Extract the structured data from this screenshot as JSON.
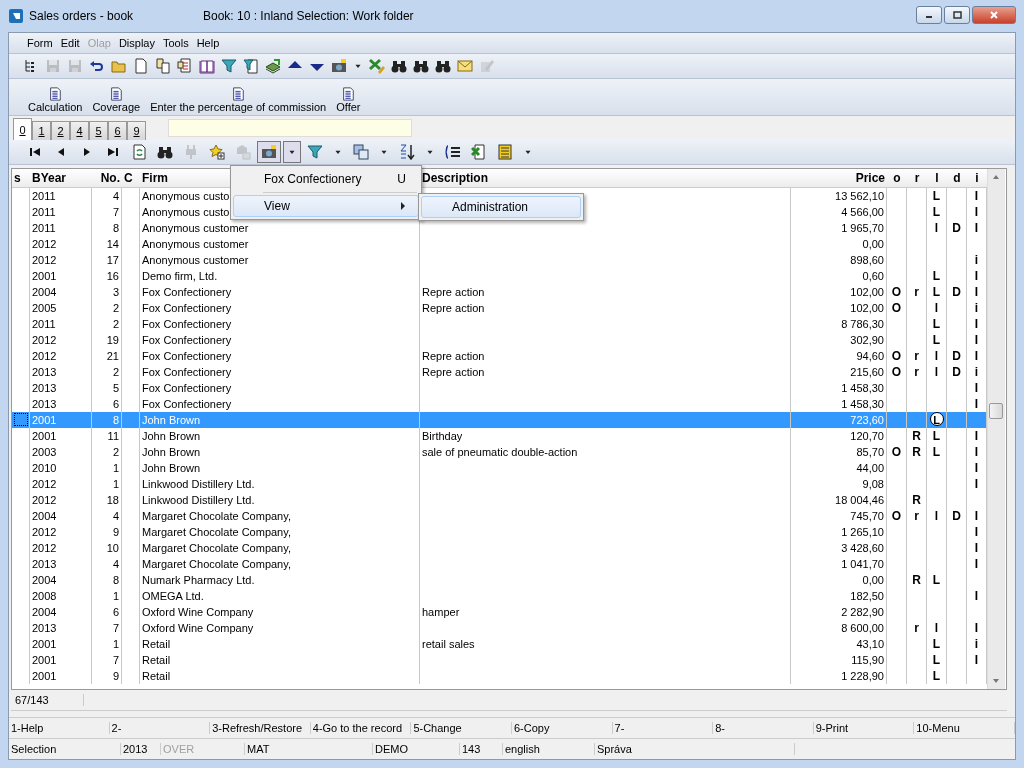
{
  "window": {
    "title": "Sales orders - book",
    "subtitle": "Book: 10 : Inland Selection: Work folder"
  },
  "menu": [
    {
      "label": "Form",
      "disabled": false
    },
    {
      "label": "Edit",
      "disabled": false
    },
    {
      "label": "Olap",
      "disabled": true
    },
    {
      "label": "Display",
      "disabled": false
    },
    {
      "label": "Tools",
      "disabled": false
    },
    {
      "label": "Help",
      "disabled": false
    }
  ],
  "toolbar": [
    {
      "disabled": false
    },
    {
      "disabled": true
    },
    {
      "disabled": true
    },
    {
      "disabled": false
    },
    {
      "disabled": false
    },
    {
      "disabled": false
    },
    {
      "disabled": false
    },
    {
      "disabled": false
    },
    {
      "disabled": false
    },
    {
      "disabled": false
    },
    {
      "disabled": false
    },
    {
      "disabled": false
    },
    {
      "disabled": false
    },
    {
      "disabled": false
    },
    {
      "disabled": false
    },
    {
      "disabled": false
    },
    {
      "disabled": false
    },
    {
      "disabled": false
    },
    {
      "disabled": false
    },
    {
      "disabled": false
    },
    {
      "disabled": false
    },
    {
      "disabled": true
    }
  ],
  "actions": [
    "Calculation",
    "Coverage",
    "Enter the percentage of commission",
    "Offer"
  ],
  "tabs": [
    {
      "label": "0",
      "selected": true
    },
    {
      "label": "1",
      "selected": false
    },
    {
      "label": "2",
      "selected": false
    },
    {
      "label": "4",
      "selected": false
    },
    {
      "label": "5",
      "selected": false
    },
    {
      "label": "6",
      "selected": false
    },
    {
      "label": "9",
      "selected": false
    }
  ],
  "nav_toolbar": [
    {
      "disabled": false,
      "pressed": false
    },
    {
      "disabled": false,
      "pressed": false
    },
    {
      "disabled": false,
      "pressed": false
    },
    {
      "disabled": false,
      "pressed": false
    },
    {
      "disabled": false,
      "pressed": false
    },
    {
      "disabled": false,
      "pressed": false
    },
    {
      "disabled": true,
      "pressed": false
    },
    {
      "disabled": false,
      "pressed": false
    },
    {
      "disabled": true,
      "pressed": false
    },
    {
      "disabled": false,
      "pressed": true
    },
    {
      "disabled": false,
      "pressed": true
    },
    {
      "disabled": false,
      "pressed": false
    },
    {
      "disabled": false,
      "pressed": false
    },
    {
      "disabled": false,
      "pressed": false
    },
    {
      "disabled": false,
      "pressed": false
    },
    {
      "disabled": false,
      "pressed": false
    },
    {
      "disabled": false,
      "pressed": false
    },
    {
      "disabled": false,
      "pressed": false
    },
    {
      "disabled": false,
      "pressed": false
    },
    {
      "disabled": false,
      "pressed": false
    },
    {
      "disabled": false,
      "pressed": false
    }
  ],
  "table": {
    "columns": [
      "s",
      "BYear",
      "No.",
      "C",
      "Firm",
      "Description",
      "Price",
      "o",
      "r",
      "l",
      "d",
      "i"
    ],
    "rows": [
      {
        "year": "2011",
        "no": "4",
        "firm": "Anonymous custo",
        "price": "13 562,10",
        "l": "L",
        "i": "I",
        "selected": false
      },
      {
        "year": "2011",
        "no": "7",
        "firm": "Anonymous custo",
        "price": "4 566,00",
        "l": "L",
        "i": "I",
        "selected": false
      },
      {
        "year": "2011",
        "no": "8",
        "firm": "Anonymous customer",
        "price": "1 965,70",
        "l": "l",
        "d": "D",
        "i": "I",
        "selected": false
      },
      {
        "year": "2012",
        "no": "14",
        "firm": "Anonymous customer",
        "price": "0,00",
        "selected": false
      },
      {
        "year": "2012",
        "no": "17",
        "firm": "Anonymous customer",
        "price": "898,60",
        "i": "i",
        "selected": false
      },
      {
        "year": "2001",
        "no": "16",
        "firm": "Demo firm, Ltd.",
        "price": "0,60",
        "l": "L",
        "i": "I",
        "selected": false
      },
      {
        "year": "2004",
        "no": "3",
        "firm": "Fox Confectionery",
        "description": "Repre action",
        "price": "102,00",
        "o": "O",
        "r": "r",
        "l": "L",
        "d": "D",
        "i": "I",
        "selected": false
      },
      {
        "year": "2005",
        "no": "2",
        "firm": "Fox Confectionery",
        "description": "Repre action",
        "price": "102,00",
        "o": "O",
        "l": "l",
        "i": "i",
        "selected": false
      },
      {
        "year": "2011",
        "no": "2",
        "firm": "Fox Confectionery",
        "price": "8 786,30",
        "l": "L",
        "i": "I",
        "selected": false
      },
      {
        "year": "2012",
        "no": "19",
        "firm": "Fox Confectionery",
        "price": "302,90",
        "l": "L",
        "i": "I",
        "selected": false
      },
      {
        "year": "2012",
        "no": "21",
        "firm": "Fox Confectionery",
        "description": "Repre action",
        "price": "94,60",
        "o": "O",
        "r": "r",
        "l": "l",
        "d": "D",
        "i": "I",
        "selected": false
      },
      {
        "year": "2013",
        "no": "2",
        "firm": "Fox Confectionery",
        "description": "Repre action",
        "price": "215,60",
        "o": "O",
        "r": "r",
        "l": "l",
        "d": "D",
        "i": "i",
        "selected": false
      },
      {
        "year": "2013",
        "no": "5",
        "firm": "Fox Confectionery",
        "price": "1 458,30",
        "i": "I",
        "selected": false
      },
      {
        "year": "2013",
        "no": "6",
        "firm": "Fox Confectionery",
        "price": "1 458,30",
        "i": "I",
        "selected": false
      },
      {
        "year": "2001",
        "no": "8",
        "firm": "John Brown",
        "price": "723,60",
        "l": "L",
        "selected": true
      },
      {
        "year": "2001",
        "no": "11",
        "firm": "John Brown",
        "description": "Birthday",
        "price": "120,70",
        "r": "R",
        "l": "L",
        "i": "I",
        "selected": false
      },
      {
        "year": "2003",
        "no": "2",
        "firm": "John Brown",
        "description": "sale of pneumatic double-action",
        "price": "85,70",
        "o": "O",
        "r": "R",
        "l": "L",
        "i": "I",
        "selected": false
      },
      {
        "year": "2010",
        "no": "1",
        "firm": "John Brown",
        "price": "44,00",
        "i": "I",
        "selected": false
      },
      {
        "year": "2012",
        "no": "1",
        "firm": "Linkwood Distillery Ltd.",
        "price": "9,08",
        "i": "I",
        "selected": false
      },
      {
        "year": "2012",
        "no": "18",
        "firm": "Linkwood Distillery Ltd.",
        "price": "18 004,46",
        "r": "R",
        "selected": false
      },
      {
        "year": "2004",
        "no": "4",
        "firm": "Margaret Chocolate Company,",
        "price": "745,70",
        "o": "O",
        "r": "r",
        "l": "l",
        "d": "D",
        "i": "I",
        "selected": false
      },
      {
        "year": "2012",
        "no": "9",
        "firm": "Margaret Chocolate Company,",
        "price": "1 265,10",
        "i": "I",
        "selected": false
      },
      {
        "year": "2012",
        "no": "10",
        "firm": "Margaret Chocolate Company,",
        "price": "3 428,60",
        "i": "I",
        "selected": false
      },
      {
        "year": "2013",
        "no": "4",
        "firm": "Margaret Chocolate Company,",
        "price": "1 041,70",
        "i": "I",
        "selected": false
      },
      {
        "year": "2004",
        "no": "8",
        "firm": "Numark Pharmacy Ltd.",
        "price": "0,00",
        "r": "R",
        "l": "L",
        "selected": false
      },
      {
        "year": "2008",
        "no": "1",
        "firm": "OMEGA Ltd.",
        "price": "182,50",
        "i": "I",
        "selected": false
      },
      {
        "year": "2004",
        "no": "6",
        "firm": "Oxford Wine Company",
        "description": "hamper",
        "price": "2 282,90",
        "selected": false
      },
      {
        "year": "2013",
        "no": "7",
        "firm": "Oxford Wine Company",
        "price": "8 600,00",
        "r": "r",
        "l": "l",
        "i": "I",
        "selected": false
      },
      {
        "year": "2001",
        "no": "1",
        "firm": "Retail",
        "description": "retail sales",
        "price": "43,10",
        "l": "L",
        "i": "i",
        "selected": false
      },
      {
        "year": "2001",
        "no": "7",
        "firm": "Retail",
        "price": "115,90",
        "l": "L",
        "i": "I",
        "selected": false
      },
      {
        "year": "2001",
        "no": "9",
        "firm": "Retail",
        "price": "1 228,90",
        "l": "L",
        "selected": false
      }
    ]
  },
  "context_menu": {
    "items": [
      {
        "label": "Fox Confectionery",
        "shortcut": "U",
        "kind": "item"
      },
      {
        "label": "View",
        "kind": "submenu"
      }
    ],
    "submenu": [
      "Administration"
    ]
  },
  "record_count": "67/143",
  "function_keys": [
    "1-Help",
    "2-",
    "3-Refresh/Restore",
    "4-Go to the record",
    "5-Change",
    "6-Copy",
    "7-",
    "8-",
    "9-Print",
    "10-Menu"
  ],
  "status_bar": [
    {
      "text": "Selection",
      "disabled": false
    },
    {
      "text": "2013",
      "disabled": false
    },
    {
      "text": "OVER",
      "disabled": true
    },
    {
      "text": "MAT",
      "disabled": false
    },
    {
      "text": "DEMO",
      "disabled": false
    },
    {
      "text": "143",
      "disabled": false
    },
    {
      "text": "english",
      "disabled": false
    },
    {
      "text": "Správa",
      "disabled": false
    }
  ]
}
